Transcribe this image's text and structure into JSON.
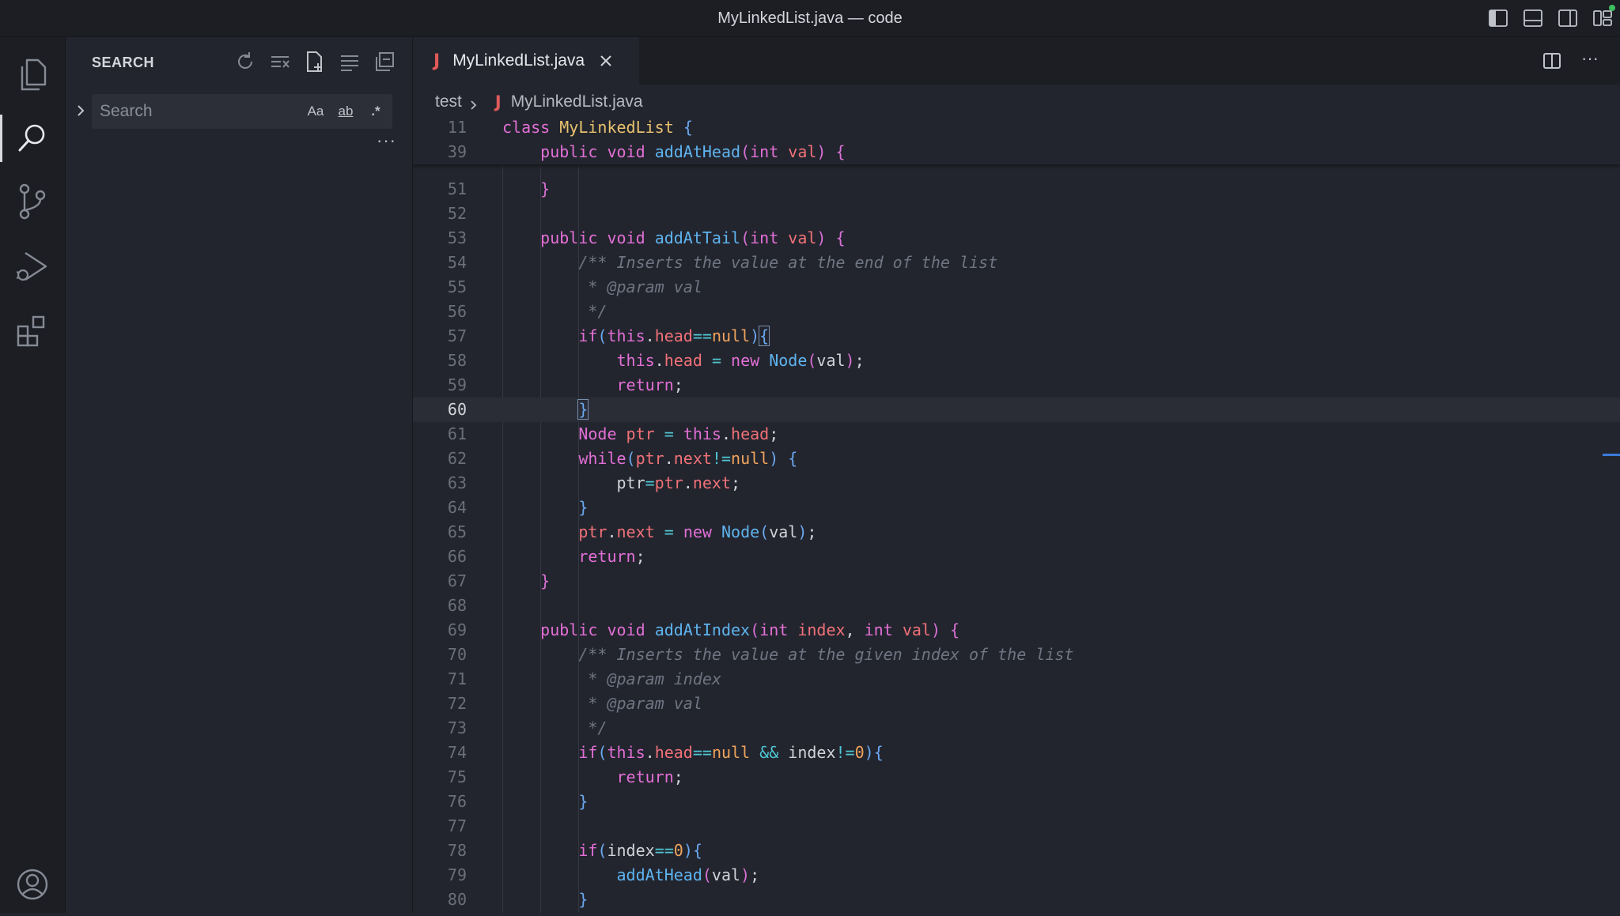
{
  "window": {
    "title": "MyLinkedList.java — code"
  },
  "activity": {
    "items": [
      {
        "name": "explorer"
      },
      {
        "name": "search",
        "active": true
      },
      {
        "name": "source-control"
      },
      {
        "name": "run-and-debug"
      },
      {
        "name": "extensions"
      }
    ],
    "account": "accounts"
  },
  "sidebar": {
    "title": "SEARCH",
    "search": {
      "placeholder": "Search",
      "value": ""
    },
    "options": {
      "match_case": "Aa",
      "whole_word": "ab",
      "regex": ".*"
    },
    "more": "···"
  },
  "editor": {
    "tab": {
      "icon": "J",
      "label": "MyLinkedList.java"
    },
    "breadcrumb": {
      "folder": "test",
      "file_icon": "J",
      "file": "MyLinkedList.java"
    },
    "more": "···",
    "sticky": [
      {
        "ln": "11",
        "html": "<span class=\"kw\">class</span> <span class=\"cls\">MyLinkedList</span> <span class=\"br\">{</span>"
      },
      {
        "ln": "39",
        "html": "    <span class=\"kw\">public</span> <span class=\"kw\">void</span> <span class=\"fn\">addAtHead</span><span class=\"br2\">(</span><span class=\"ty\">int</span> <span class=\"prop\">val</span><span class=\"br2\">)</span> <span class=\"br2\">{</span>"
      }
    ],
    "current_line": "60",
    "lines": [
      {
        "ln": "51",
        "html": "    <span class=\"br2\">}</span>"
      },
      {
        "ln": "52",
        "html": ""
      },
      {
        "ln": "53",
        "html": "    <span class=\"kw\">public</span> <span class=\"kw\">void</span> <span class=\"fn\">addAtTail</span><span class=\"br2\">(</span><span class=\"ty\">int</span> <span class=\"prop\">val</span><span class=\"br2\">)</span> <span class=\"br2\">{</span>"
      },
      {
        "ln": "54",
        "html": "        <span class=\"cmt\">/** Inserts the value at the end of the list</span>"
      },
      {
        "ln": "55",
        "html": "        <span class=\"cmt\"> * @param val</span>"
      },
      {
        "ln": "56",
        "html": "        <span class=\"cmt\"> */</span>"
      },
      {
        "ln": "57",
        "html": "        <span class=\"kw\">if</span><span class=\"br\">(</span><span class=\"kw\">this</span>.<span class=\"prop\">head</span><span class=\"op\">==</span><span class=\"num\">null</span><span class=\"br\">)</span><span class=\"brm\">{</span>"
      },
      {
        "ln": "58",
        "html": "            <span class=\"kw\">this</span>.<span class=\"prop\">head</span> <span class=\"op\">=</span> <span class=\"kw\">new</span> <span class=\"fn\">Node</span><span class=\"br2\">(</span>val<span class=\"br2\">)</span>;"
      },
      {
        "ln": "59",
        "html": "            <span class=\"kw\">return</span>;"
      },
      {
        "ln": "60",
        "html": "        <span class=\"brm\">}</span>"
      },
      {
        "ln": "61",
        "html": "        <span class=\"ty\">Node</span> <span class=\"prop\">ptr</span> <span class=\"op\">=</span> <span class=\"kw\">this</span>.<span class=\"prop\">head</span>;"
      },
      {
        "ln": "62",
        "html": "        <span class=\"kw\">while</span><span class=\"br\">(</span><span class=\"prop\">ptr</span>.<span class=\"prop\">next</span><span class=\"op\">!=</span><span class=\"num\">null</span><span class=\"br\">)</span> <span class=\"br\">{</span>"
      },
      {
        "ln": "63",
        "html": "            ptr<span class=\"op\">=</span><span class=\"prop\">ptr</span>.<span class=\"prop\">next</span>;"
      },
      {
        "ln": "64",
        "html": "        <span class=\"br\">}</span>"
      },
      {
        "ln": "65",
        "html": "        <span class=\"prop\">ptr</span>.<span class=\"prop\">next</span> <span class=\"op\">=</span> <span class=\"kw\">new</span> <span class=\"fn\">Node</span><span class=\"br\">(</span>val<span class=\"br\">)</span>;"
      },
      {
        "ln": "66",
        "html": "        <span class=\"kw\">return</span>;"
      },
      {
        "ln": "67",
        "html": "    <span class=\"br2\">}</span>"
      },
      {
        "ln": "68",
        "html": ""
      },
      {
        "ln": "69",
        "html": "    <span class=\"kw\">public</span> <span class=\"kw\">void</span> <span class=\"fn\">addAtIndex</span><span class=\"br2\">(</span><span class=\"ty\">int</span> <span class=\"prop\">index</span>, <span class=\"ty\">int</span> <span class=\"prop\">val</span><span class=\"br2\">)</span> <span class=\"br2\">{</span>"
      },
      {
        "ln": "70",
        "html": "        <span class=\"cmt\">/** Inserts the value at the given index of the list</span>"
      },
      {
        "ln": "71",
        "html": "        <span class=\"cmt\"> * @param index</span>"
      },
      {
        "ln": "72",
        "html": "        <span class=\"cmt\"> * @param val</span>"
      },
      {
        "ln": "73",
        "html": "        <span class=\"cmt\"> */</span>"
      },
      {
        "ln": "74",
        "html": "        <span class=\"kw\">if</span><span class=\"br\">(</span><span class=\"kw\">this</span>.<span class=\"prop\">head</span><span class=\"op\">==</span><span class=\"num\">null</span> <span class=\"op\">&amp;&amp;</span> index<span class=\"op\">!=</span><span class=\"num\">0</span><span class=\"br\">){</span>"
      },
      {
        "ln": "75",
        "html": "            <span class=\"kw\">return</span>;"
      },
      {
        "ln": "76",
        "html": "        <span class=\"br\">}</span>"
      },
      {
        "ln": "77",
        "html": ""
      },
      {
        "ln": "78",
        "html": "        <span class=\"kw\">if</span><span class=\"br\">(</span>index<span class=\"op\">==</span><span class=\"num\">0</span><span class=\"br\">){</span>"
      },
      {
        "ln": "79",
        "html": "            <span class=\"fn\">addAtHead</span><span class=\"br2\">(</span>val<span class=\"br2\">)</span>;"
      },
      {
        "ln": "80",
        "html": "        <span class=\"br\">}</span>"
      }
    ]
  }
}
